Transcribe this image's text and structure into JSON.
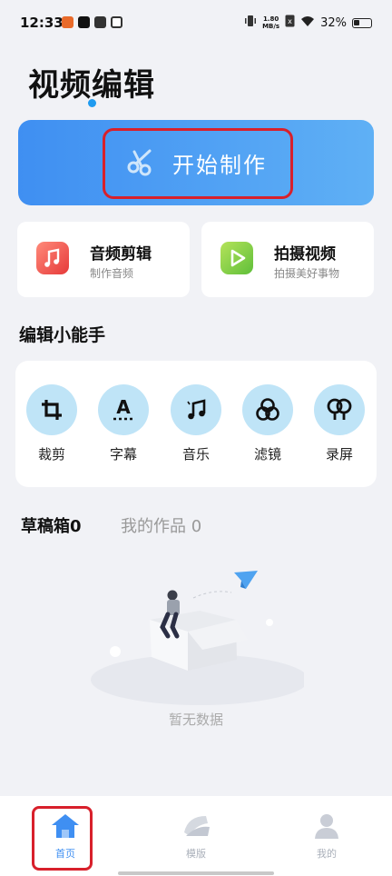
{
  "status_bar": {
    "time": "12:33",
    "speed_value": "1.80",
    "speed_unit": "MB/s",
    "battery": "32%"
  },
  "page_title": "视频编辑",
  "start_button": {
    "label": "开始制作"
  },
  "features": [
    {
      "title": "音频剪辑",
      "subtitle": "制作音频"
    },
    {
      "title": "拍摄视频",
      "subtitle": "拍摄美好事物"
    }
  ],
  "tools_section": {
    "title": "编辑小能手",
    "items": [
      {
        "label": "裁剪",
        "icon": "crop-icon"
      },
      {
        "label": "字幕",
        "icon": "subtitle-icon"
      },
      {
        "label": "音乐",
        "icon": "music-note-icon"
      },
      {
        "label": "滤镜",
        "icon": "filter-icon"
      },
      {
        "label": "录屏",
        "icon": "screen-record-icon"
      }
    ]
  },
  "drafts_tabs": {
    "drafts": "草稿箱0",
    "works": "我的作品 0"
  },
  "empty_state": {
    "text": "暂无数据"
  },
  "bottom_nav": [
    {
      "label": "首页",
      "icon": "home-icon",
      "active": true
    },
    {
      "label": "模版",
      "icon": "template-icon",
      "active": false
    },
    {
      "label": "我的",
      "icon": "profile-icon",
      "active": false
    }
  ],
  "colors": {
    "accent": "#3f8ff2",
    "annotation": "#d8202b",
    "tool_circle": "#bfe4f7",
    "background": "#f1f2f6"
  }
}
